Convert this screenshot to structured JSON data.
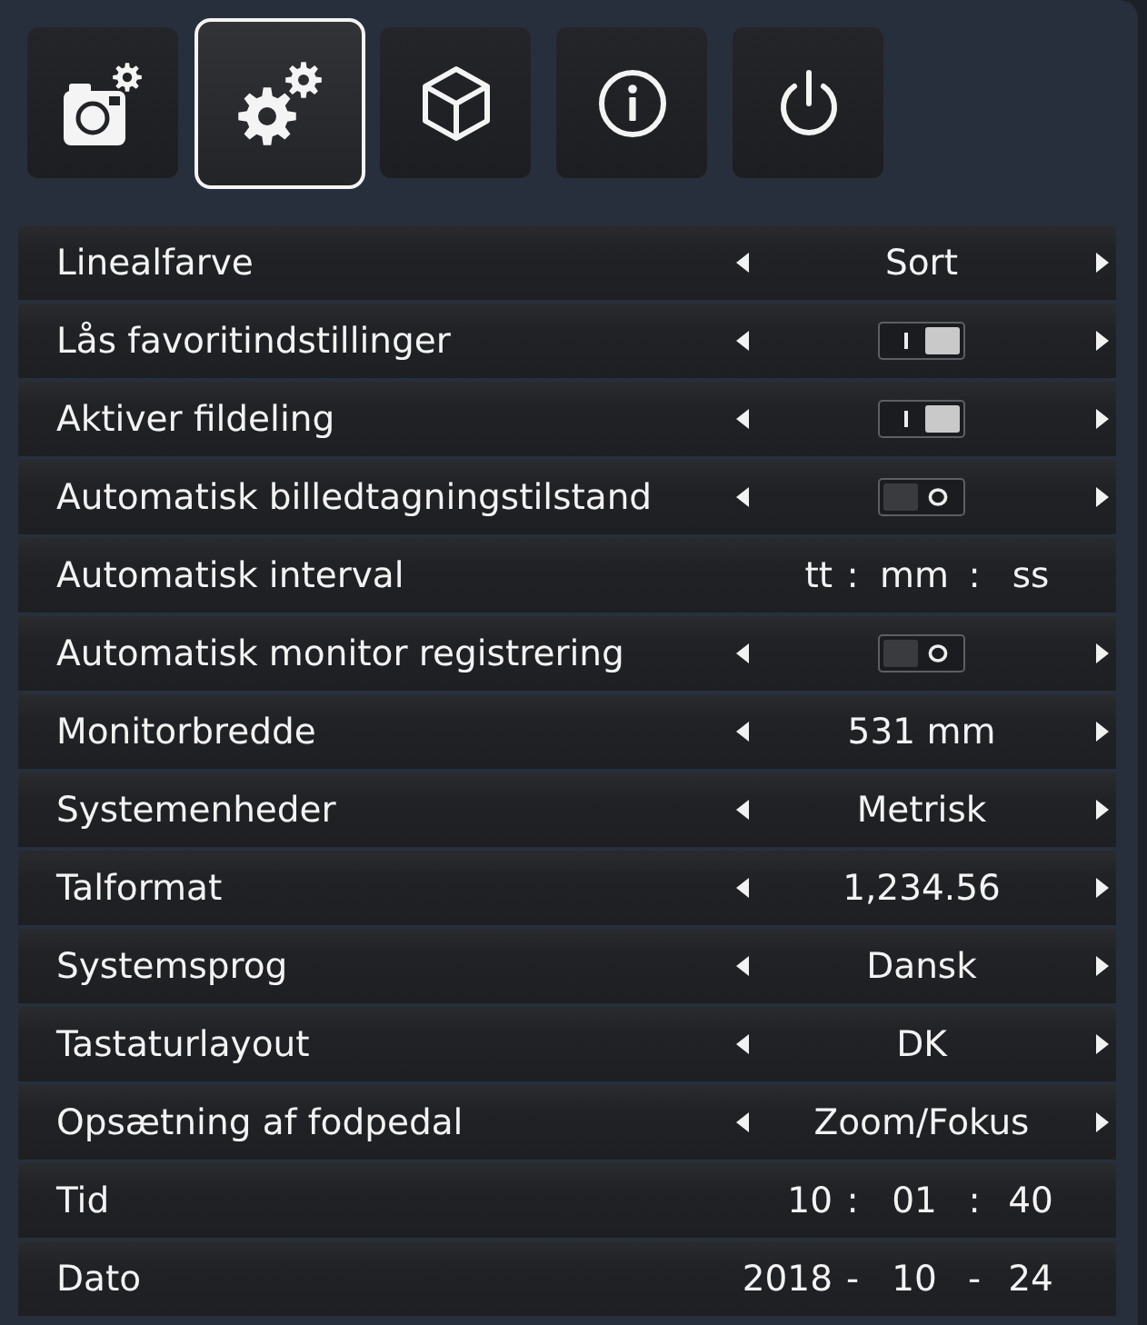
{
  "tabs": [
    {
      "kind": "camera",
      "selected": false
    },
    {
      "kind": "settings",
      "selected": true
    },
    {
      "kind": "cube",
      "selected": false
    },
    {
      "kind": "info",
      "selected": false
    },
    {
      "kind": "power",
      "selected": false
    }
  ],
  "settings": [
    {
      "kind": "choice",
      "label": "Linealfarve",
      "value": "Sort"
    },
    {
      "kind": "toggle",
      "label": "Lås favoritindstillinger",
      "on": true
    },
    {
      "kind": "toggle",
      "label": "Aktiver fildeling",
      "on": true
    },
    {
      "kind": "toggle",
      "label": "Automatisk billedtagningstilstand",
      "on": false
    },
    {
      "kind": "fields",
      "label": "Automatisk interval",
      "parts": [
        {
          "kind": "field",
          "placeholder": "tt"
        },
        {
          "kind": "separator",
          "text": ":"
        },
        {
          "kind": "field",
          "placeholder": "mm"
        },
        {
          "kind": "separator",
          "text": ":"
        },
        {
          "kind": "field",
          "placeholder": "ss"
        }
      ]
    },
    {
      "kind": "toggle",
      "label": "Automatisk monitor registrering",
      "on": false
    },
    {
      "kind": "choice",
      "label": "Monitorbredde",
      "value": "531 mm"
    },
    {
      "kind": "choice",
      "label": "Systemenheder",
      "value": "Metrisk"
    },
    {
      "kind": "choice",
      "label": "Talformat",
      "value": "1,234.56"
    },
    {
      "kind": "choice",
      "label": "Systemsprog",
      "value": "Dansk"
    },
    {
      "kind": "choice",
      "label": "Tastaturlayout",
      "value": "DK"
    },
    {
      "kind": "choice",
      "label": "Opsætning af fodpedal",
      "value": "Zoom/Fokus"
    },
    {
      "kind": "fields",
      "label": "Tid",
      "parts": [
        {
          "kind": "field",
          "value": "10"
        },
        {
          "kind": "separator",
          "text": ":"
        },
        {
          "kind": "field",
          "value": "01"
        },
        {
          "kind": "separator",
          "text": ":"
        },
        {
          "kind": "field",
          "value": "40"
        }
      ]
    },
    {
      "kind": "fields",
      "label": "Dato",
      "parts": [
        {
          "kind": "field",
          "value": "2018"
        },
        {
          "kind": "separator",
          "text": "-"
        },
        {
          "kind": "field",
          "value": "10"
        },
        {
          "kind": "separator",
          "text": "-"
        },
        {
          "kind": "field",
          "value": "24"
        }
      ]
    }
  ]
}
